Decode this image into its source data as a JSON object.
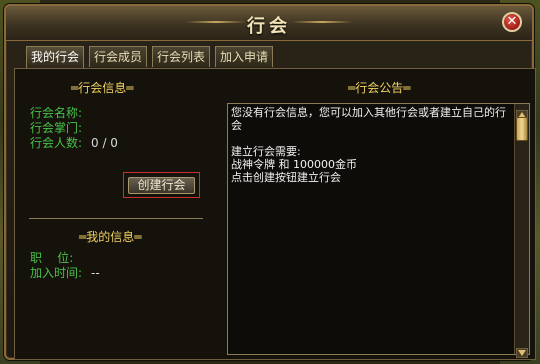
{
  "window": {
    "title": "行会"
  },
  "tabs": [
    {
      "label": "我的行会",
      "active": true
    },
    {
      "label": "行会成员",
      "active": false
    },
    {
      "label": "行会列表",
      "active": false
    },
    {
      "label": "加入申请",
      "active": false
    }
  ],
  "guild_info": {
    "section_title": "═行会信息═",
    "name_label": "行会名称:",
    "name_value": "",
    "leader_label": "行会掌门:",
    "leader_value": "",
    "members_label": "行会人数:",
    "members_value": "0 / 0"
  },
  "create_button": {
    "label": "创建行会"
  },
  "my_info": {
    "section_title": "═我的信息═",
    "position_label": "职    位:",
    "position_value": "",
    "join_time_label": "加入时间:",
    "join_time_value": "--"
  },
  "notice": {
    "section_title": "═行会公告═",
    "text": "您没有行会信息，您可以加入其他行会或者建立自己的行会\n\n建立行会需要:\n战神令牌 和 100000金币\n点击创建按钮建立行会"
  },
  "icons": {
    "close": "close-x-icon",
    "scroll_up": "triangle-up-icon",
    "scroll_down": "triangle-down-icon"
  },
  "colors": {
    "label_green": "#48c048",
    "section_gold": "#f0d060",
    "highlight_red": "#c83030"
  }
}
